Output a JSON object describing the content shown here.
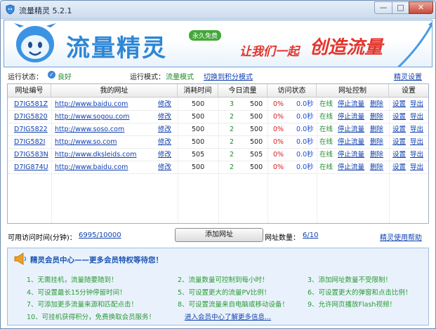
{
  "window": {
    "title": "流量精灵 5.2.1"
  },
  "titlebar": {
    "min_label": "—",
    "max_label": "□",
    "close_label": "✕"
  },
  "banner": {
    "brand": "流量精灵",
    "badge": "永久免费",
    "slogan_a": "让我们一起",
    "slogan_b": "创造流量"
  },
  "status": {
    "state_label": "运行状态：",
    "state_value": "良好",
    "mode_label": "运行模式：",
    "mode_value": "流量模式",
    "switch_link": "切换到积分模式",
    "settings_link": "精灵设置"
  },
  "table": {
    "columns": [
      "网址编号",
      "我的网址",
      "消耗时间",
      "今日流量",
      "访问状态",
      "网址控制",
      "设置"
    ],
    "rows": [
      {
        "id": "D7IG581Z",
        "url": "http://www.baidu.com",
        "edit": "修改",
        "time": "500",
        "count": "3",
        "flow": "500",
        "percent": "0%",
        "sec": "0.0秒",
        "online": "在线",
        "stop": "停止流量",
        "delete": "删除",
        "settings": "设置",
        "export": "导出"
      },
      {
        "id": "D7IG5820",
        "url": "http://www.sogou.com",
        "edit": "修改",
        "time": "500",
        "count": "2",
        "flow": "500",
        "percent": "0%",
        "sec": "0.0秒",
        "online": "在线",
        "stop": "停止流量",
        "delete": "删除",
        "settings": "设置",
        "export": "导出"
      },
      {
        "id": "D7IG5822",
        "url": "http://www.soso.com",
        "edit": "修改",
        "time": "500",
        "count": "2",
        "flow": "500",
        "percent": "0%",
        "sec": "0.0秒",
        "online": "在线",
        "stop": "停止流量",
        "delete": "删除",
        "settings": "设置",
        "export": "导出"
      },
      {
        "id": "D7IG582I",
        "url": "http://www.so.com",
        "edit": "修改",
        "time": "500",
        "count": "2",
        "flow": "500",
        "percent": "0%",
        "sec": "0.0秒",
        "online": "在线",
        "stop": "停止流量",
        "delete": "删除",
        "settings": "设置",
        "export": "导出"
      },
      {
        "id": "D7IG583N",
        "url": "http://www.dksleids.com",
        "edit": "修改",
        "time": "505",
        "count": "2",
        "flow": "505",
        "percent": "0%",
        "sec": "0.0秒",
        "online": "在线",
        "stop": "停止流量",
        "delete": "删除",
        "settings": "设置",
        "export": "导出"
      },
      {
        "id": "D7IG874U",
        "url": "http://www.baidu.com",
        "edit": "修改",
        "time": "500",
        "count": "2",
        "flow": "500",
        "percent": "0%",
        "sec": "0.0秒",
        "online": "在线",
        "stop": "停止流量",
        "delete": "删除",
        "settings": "设置",
        "export": "导出"
      }
    ]
  },
  "footer": {
    "time_label": "可用访问时间(分钟)：",
    "time_value": "6995/10000",
    "add_button": "添加网址",
    "count_label": "网址数量：",
    "count_value": "6/10",
    "help_link": "精灵使用帮助"
  },
  "member": {
    "title": "精灵会员中心——更多会员特权等待您！",
    "perks": [
      "1、无需挂机，流量随要随到！",
      "2、流量数量可控制到每小时！",
      "3、添加网址数量不受限制！",
      "4、可设置最长15分钟停留时间！",
      "5、可设置更大的流量PV比例！",
      "6、可设置更大的弹窗和点击比例！",
      "7、可添加更多流量来源和匹配点击！",
      "8、可设置流量来自电脑或移动设备！",
      "9、允许网页播放Flash视频！",
      "10、可挂机获得积分，免费换取会员服务！"
    ],
    "link": "进入会员中心了解更多信息..."
  },
  "colors": {
    "accent": "#2e86d4",
    "slogan": "#e4342b",
    "ok": "#238a2a",
    "link": "#1040b0"
  }
}
